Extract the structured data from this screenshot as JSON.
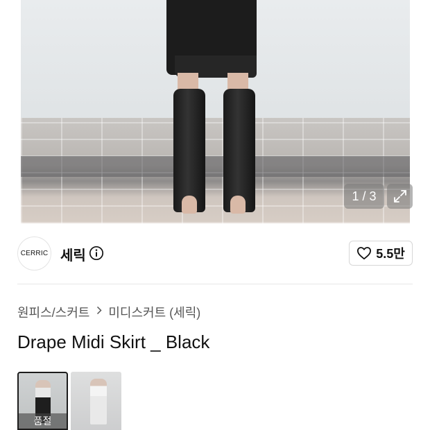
{
  "gallery": {
    "counter": "1 / 3",
    "current": 1,
    "total": 3
  },
  "brand": {
    "logo_text": "CERRIC",
    "name": "세릭"
  },
  "like": {
    "count": "5.5만"
  },
  "breadcrumb": {
    "items": [
      "원피스/스커트",
      "미디스커트 (세릭)"
    ]
  },
  "product": {
    "title": "Drape Midi Skirt _ Black"
  },
  "thumbnails": [
    {
      "badge": "품절",
      "selected": true
    },
    {
      "badge": "",
      "selected": false
    }
  ],
  "icons": {
    "info": "info-circle-icon",
    "heart": "heart-outline-icon",
    "expand": "expand-icon",
    "chevron": "chevron-right-icon"
  }
}
